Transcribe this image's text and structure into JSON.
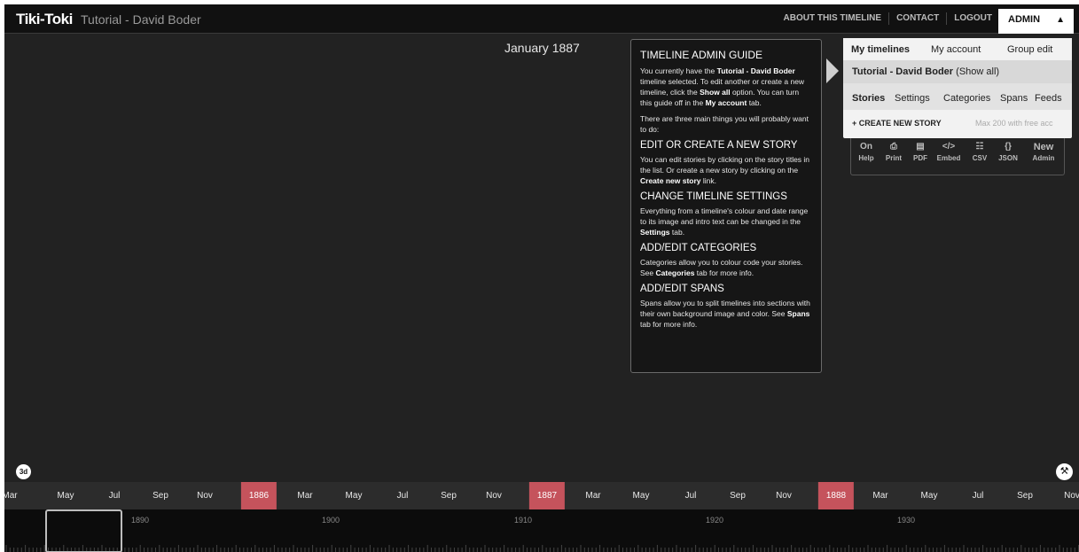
{
  "header": {
    "brand": "Tiki-Toki",
    "title": "Tutorial - David Boder",
    "nav": [
      "ABOUT THIS TIMELINE",
      "CONTACT",
      "LOGOUT"
    ],
    "admin_label": "ADMIN",
    "admin_arrow": "▲"
  },
  "date_header": "January 1887",
  "guide": {
    "title": "TIMELINE ADMIN GUIDE",
    "intro_1": "You currently have the ",
    "intro_bold_1": "Tutorial - David Boder",
    "intro_2": " timeline selected. To edit another or create a new timeline, click the ",
    "intro_bold_2": "Show all",
    "intro_3": " option. You can turn this guide off in the ",
    "intro_bold_3": "My account",
    "intro_4": " tab.",
    "three_things": "There are three main things you will probably want to do:",
    "s1_title": "EDIT OR CREATE A NEW STORY",
    "s1_text_1": "You can edit stories by clicking on the story titles in the list. Or create a new story by clicking on the ",
    "s1_bold": "Create new story",
    "s1_text_2": " link.",
    "s2_title": "CHANGE TIMELINE SETTINGS",
    "s2_text_1": "Everything from a timeline's colour and date range to its image and intro text can be changed in the ",
    "s2_bold": "Settings",
    "s2_text_2": " tab.",
    "s3_title": "ADD/EDIT CATEGORIES",
    "s3_text_1": "Categories allow you to colour code your stories. See ",
    "s3_bold": "Categories",
    "s3_text_2": " tab for more info.",
    "s4_title": "ADD/EDIT SPANS",
    "s4_text_1": "Spans allow you to split timelines into sections with their own background image and color. See ",
    "s4_bold": "Spans",
    "s4_text_2": " tab for more info."
  },
  "dropdown": {
    "tabs": [
      "My timelines",
      "My account",
      "Group edit"
    ],
    "timeline_name": "Tutorial - David Boder",
    "show_all": " (Show all)",
    "sub_tabs": [
      "Stories",
      "Settings",
      "Categories",
      "Spans",
      "Feeds"
    ],
    "create_story": "+ CREATE NEW STORY",
    "max_note": "Max 200 with free acc"
  },
  "toolbar": [
    {
      "icon": "On",
      "label": "Help",
      "icon_name": "help-toggle-icon"
    },
    {
      "icon": "⎙",
      "label": "Print",
      "icon_name": "print-icon"
    },
    {
      "icon": "▤",
      "label": "PDF",
      "icon_name": "pdf-icon"
    },
    {
      "icon": "</>",
      "label": "Embed",
      "icon_name": "embed-icon"
    },
    {
      "icon": "☷",
      "label": "CSV",
      "icon_name": "csv-icon"
    },
    {
      "icon": "{}",
      "label": "JSON",
      "icon_name": "json-icon"
    },
    {
      "icon": "New",
      "label": "Admin",
      "icon_name": "new-admin-icon"
    }
  ],
  "controls": {
    "btn_3d": "3d",
    "settings_icon": "wrench-icon"
  },
  "months": [
    "Mar",
    "May",
    "Jul",
    "Sep",
    "Nov",
    "1886",
    "Mar",
    "May",
    "Jul",
    "Sep",
    "Nov",
    "1887",
    "Mar",
    "May",
    "Jul",
    "Sep",
    "Nov",
    "1888",
    "Mar",
    "May",
    "Jul",
    "Sep",
    "Nov"
  ],
  "overview_years": [
    "1890",
    "1900",
    "1910",
    "1920",
    "1930"
  ],
  "colors": {
    "year_marker": "#c5535c",
    "background": "#222222",
    "header": "#111111"
  }
}
